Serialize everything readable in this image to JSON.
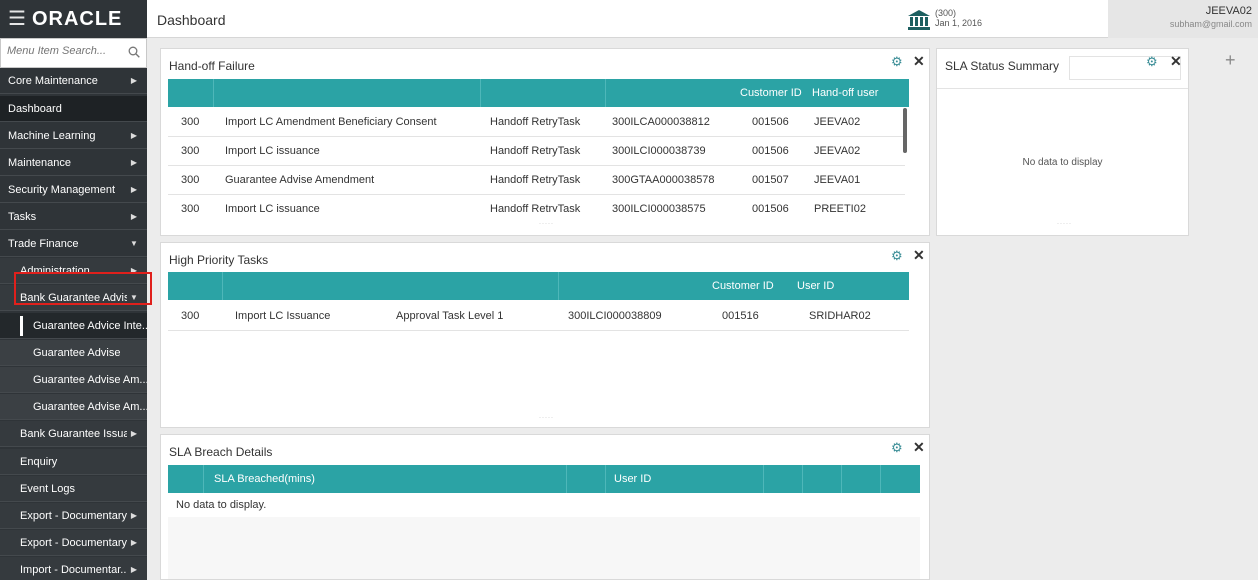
{
  "header": {
    "logo": "ORACLE",
    "page_title": "Dashboard",
    "branch_code": "(300)",
    "branch_date": "Jan 1, 2016",
    "user_name": "JEEVA02",
    "user_email": "subham@gmail.com"
  },
  "sidebar": {
    "search_placeholder": "Menu Item Search...",
    "items": [
      {
        "label": "Core Maintenance",
        "arrow": "▶"
      },
      {
        "label": "Dashboard"
      },
      {
        "label": "Machine Learning",
        "arrow": "▶"
      },
      {
        "label": "Maintenance",
        "arrow": "▶"
      },
      {
        "label": "Security Management",
        "arrow": "▶"
      },
      {
        "label": "Tasks",
        "arrow": "▶"
      },
      {
        "label": "Trade Finance",
        "arrow": "▼"
      },
      {
        "label": "Administration",
        "arrow": "▶"
      },
      {
        "label": "Bank Guarantee Advise",
        "arrow": "▼"
      },
      {
        "label": "Guarantee Advice Inte..."
      },
      {
        "label": "Guarantee Advise"
      },
      {
        "label": "Guarantee Advise Am..."
      },
      {
        "label": "Guarantee Advise Am..."
      },
      {
        "label": "Bank Guarantee Issua...",
        "arrow": "▶"
      },
      {
        "label": "Enquiry"
      },
      {
        "label": "Event Logs"
      },
      {
        "label": "Export - Documentary...",
        "arrow": "▶"
      },
      {
        "label": "Export - Documentary...",
        "arrow": "▶"
      },
      {
        "label": "Import - Documentar...",
        "arrow": "▶"
      }
    ]
  },
  "handoff": {
    "title": "Hand-off Failure",
    "columns": [
      "Customer ID",
      "Hand-off user"
    ],
    "rows": [
      [
        "300",
        "Import LC Amendment Beneficiary Consent",
        "Handoff RetryTask",
        "300ILCA000038812",
        "001506",
        "JEEVA02"
      ],
      [
        "300",
        "Import LC issuance",
        "Handoff RetryTask",
        "300ILCI000038739",
        "001506",
        "JEEVA02"
      ],
      [
        "300",
        "Guarantee Advise Amendment",
        "Handoff RetryTask",
        "300GTAA000038578",
        "001507",
        "JEEVA01"
      ],
      [
        "300",
        "Import LC issuance",
        "Handoff RetryTask",
        "300ILCI000038575",
        "001506",
        "PREETI02"
      ]
    ]
  },
  "sla_summary": {
    "title": "SLA Status Summary",
    "empty": "No data to display"
  },
  "high_priority": {
    "title": "High Priority Tasks",
    "columns": [
      "Customer ID",
      "User ID"
    ],
    "rows": [
      [
        "300",
        "Import LC Issuance",
        "Approval Task Level 1",
        "300ILCI000038809",
        "001516",
        "SRIDHAR02"
      ]
    ]
  },
  "sla_breach": {
    "title": "SLA Breach Details",
    "columns": [
      "SLA Breached(mins)",
      "User ID"
    ],
    "empty": "No data to display."
  },
  "colors": {
    "table_header": "#2ba3a5",
    "sidebar_bg": "#2f3438",
    "gear": "#3a8d96",
    "highlight": "#e0201c"
  },
  "icons": {
    "menu": "☰",
    "gear": "⚙",
    "close": "✕",
    "plus": "+"
  }
}
